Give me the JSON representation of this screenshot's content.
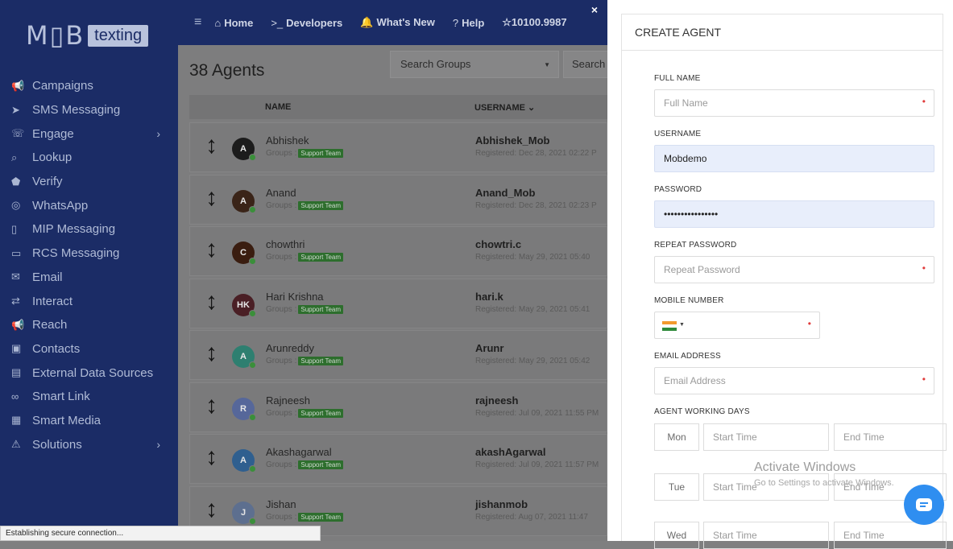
{
  "logo": {
    "mob": "M▯B",
    "texting": "texting"
  },
  "sidebar": {
    "items": [
      {
        "label": "Campaigns",
        "icon": "megaphone-icon",
        "glyph": "📢"
      },
      {
        "label": "SMS Messaging",
        "icon": "send-icon",
        "glyph": "➤"
      },
      {
        "label": "Engage",
        "icon": "phone-icon",
        "glyph": "☏",
        "chevron": "›"
      },
      {
        "label": "Lookup",
        "icon": "search-icon",
        "glyph": "⌕"
      },
      {
        "label": "Verify",
        "icon": "shield-icon",
        "glyph": "⬟"
      },
      {
        "label": "WhatsApp",
        "icon": "whatsapp-icon",
        "glyph": "◎"
      },
      {
        "label": "MIP Messaging",
        "icon": "mobile-icon",
        "glyph": "▯"
      },
      {
        "label": "RCS Messaging",
        "icon": "chat-icon",
        "glyph": "▭"
      },
      {
        "label": "Email",
        "icon": "envelope-icon",
        "glyph": "✉"
      },
      {
        "label": "Interact",
        "icon": "ticket-icon",
        "glyph": "⇄"
      },
      {
        "label": "Reach",
        "icon": "megaphone-icon",
        "glyph": "📢"
      },
      {
        "label": "Contacts",
        "icon": "contacts-icon",
        "glyph": "▣"
      },
      {
        "label": "External Data Sources",
        "icon": "database-icon",
        "glyph": "▤"
      },
      {
        "label": "Smart Link",
        "icon": "link-icon",
        "glyph": "∞"
      },
      {
        "label": "Smart Media",
        "icon": "media-icon",
        "glyph": "▦"
      },
      {
        "label": "Solutions",
        "icon": "warning-icon",
        "glyph": "⚠",
        "chevron": "›"
      }
    ]
  },
  "topbar": {
    "menu_glyph": "≡",
    "home": "Home",
    "home_glyph": "⌂",
    "developers": "Developers",
    "developers_glyph": ">_",
    "whats_new": "What's New",
    "whats_new_glyph": "🔔",
    "help": "Help",
    "help_glyph": "?",
    "credits": "☆10100.9987",
    "close": "×"
  },
  "main": {
    "title": "38 Agents",
    "search_groups_placeholder": "Search Groups",
    "search2_placeholder": "Search",
    "col_name": "NAME",
    "col_username": "USERNAME ⌄",
    "groups_label": "Groups :",
    "rows": [
      {
        "initials": "A",
        "name": "Abhishek",
        "group": "Support Team",
        "username": "Abhishek_Mob",
        "registered": "Registered: Dec 28, 2021 02:22 P",
        "color": "#1c1c1c"
      },
      {
        "initials": "A",
        "name": "Anand",
        "group": "Support Team",
        "username": "Anand_Mob",
        "registered": "Registered: Dec 28, 2021 02:23 P",
        "color": "#3a2418"
      },
      {
        "initials": "C",
        "name": "chowthri",
        "group": "Support Team",
        "username": "chowtri.c",
        "registered": "Registered: May 29, 2021 05:40",
        "color": "#3a1d10"
      },
      {
        "initials": "HK",
        "name": "Hari Krishna",
        "group": "Support Team",
        "username": "hari.k",
        "registered": "Registered: May 29, 2021 05:41",
        "color": "#4a1f25"
      },
      {
        "initials": "A",
        "name": "Arunreddy",
        "group": "Support Team",
        "username": "Arunr",
        "registered": "Registered: May 29, 2021 05:42",
        "color": "#2e7f70"
      },
      {
        "initials": "R",
        "name": "Rajneesh",
        "group": "Support Team",
        "username": "rajneesh",
        "registered": "Registered: Jul 09, 2021 11:55 PM",
        "color": "#56679a"
      },
      {
        "initials": "A",
        "name": "Akashagarwal",
        "group": "Support Team",
        "username": "akashAgarwal",
        "registered": "Registered: Jul 09, 2021 11:57 PM",
        "color": "#2f5f8f"
      },
      {
        "initials": "J",
        "name": "Jishan",
        "group": "Support Team",
        "username": "jishanmob",
        "registered": "Registered: Aug 07, 2021 11:47",
        "color": "#5d6f8f"
      }
    ]
  },
  "status_bar": "Establishing secure connection...",
  "panel": {
    "title": "CREATE AGENT",
    "full_name_label": "FULL NAME",
    "full_name_placeholder": "Full Name",
    "username_label": "USERNAME",
    "username_value": "Mobdemo",
    "password_label": "PASSWORD",
    "password_value": "••••••••••••••••",
    "repeat_label": "REPEAT PASSWORD",
    "repeat_placeholder": "Repeat Password",
    "mobile_label": "MOBILE NUMBER",
    "email_label": "EMAIL ADDRESS",
    "email_placeholder": "Email Address",
    "days_label": "AGENT WORKING DAYS",
    "required_mark": "•",
    "start_time": "Start Time",
    "end_time": "End Time",
    "days": [
      "Mon",
      "Tue",
      "Wed"
    ]
  },
  "watermark": {
    "line1": "Activate Windows",
    "line2": "Go to Settings to activate Windows."
  },
  "colors": {
    "sidebar": "#1b2c66",
    "required": "#e03b3b",
    "chat_button": "#2f8ef0",
    "badge": "#2d6e2d"
  }
}
